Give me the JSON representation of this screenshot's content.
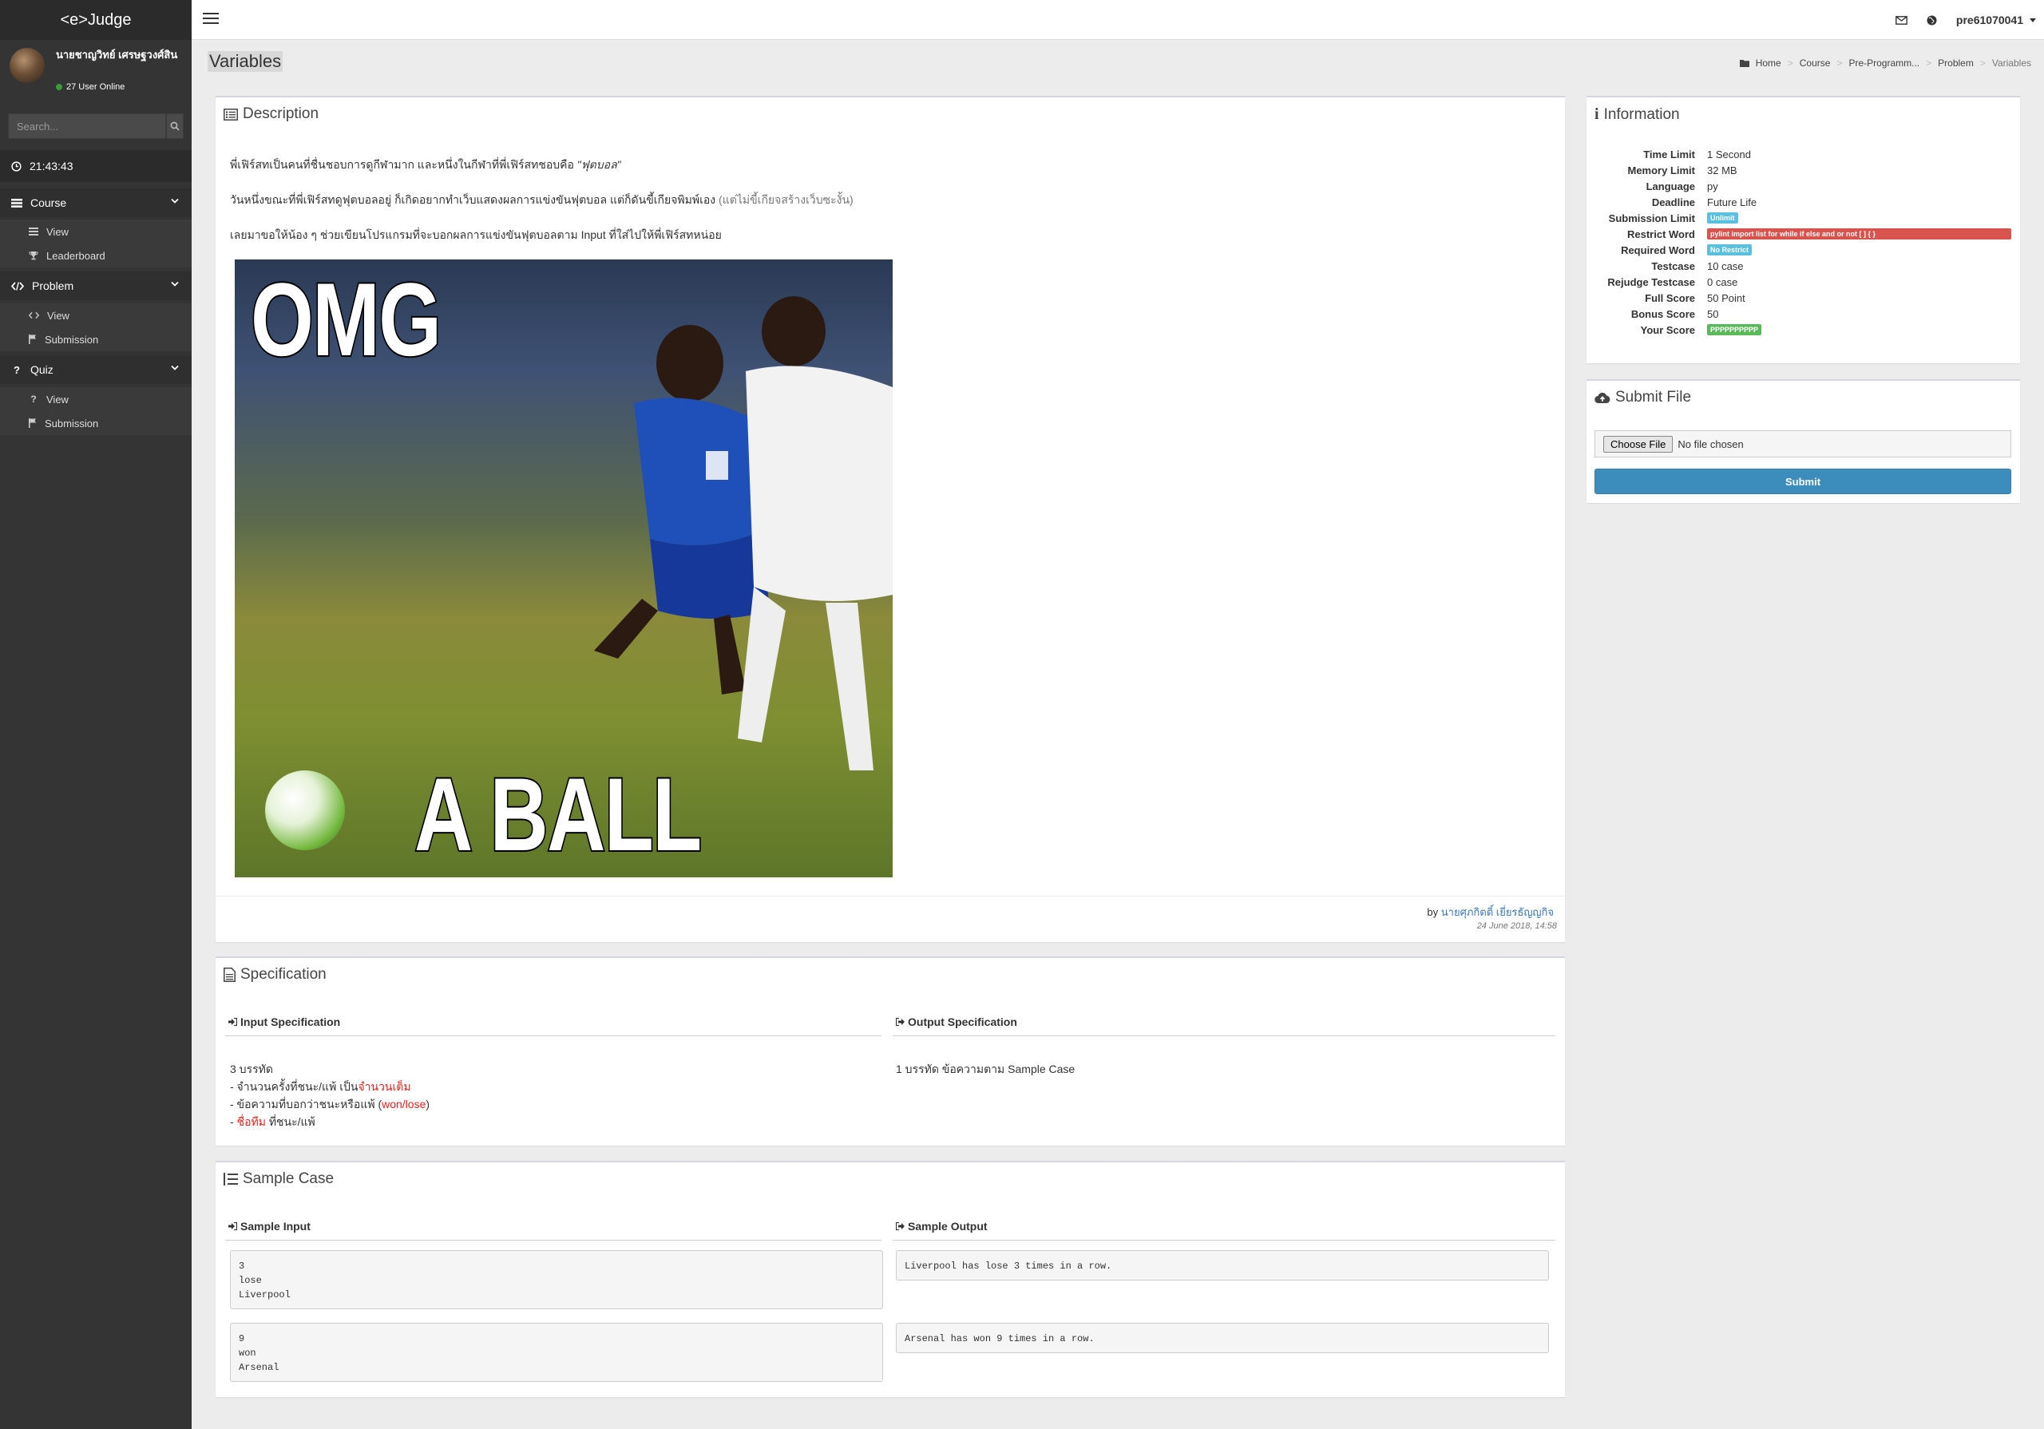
{
  "app": {
    "brand": "<e>Judge"
  },
  "user": {
    "name": "นายชาญวิทย์ เศรษฐวงศ์สิน",
    "online": "27 User Online",
    "username": "pre61070041"
  },
  "search": {
    "placeholder": "Search..."
  },
  "clock": "21:43:43",
  "menu": {
    "course": {
      "label": "Course",
      "items": [
        "View",
        "Leaderboard"
      ]
    },
    "problem": {
      "label": "Problem",
      "items": [
        "View",
        "Submission"
      ]
    },
    "quiz": {
      "label": "Quiz",
      "items": [
        "View",
        "Submission"
      ]
    }
  },
  "page": {
    "title": "Variables"
  },
  "breadcrumb": [
    "Home",
    "Course",
    "Pre-Programm...",
    "Problem",
    "Variables"
  ],
  "description": {
    "title": "Description",
    "p1_a": "พี่เฟิร์สทเป็นคนที่ชื่นชอบการดูกีฬามาก และหนึ่งในกีฬาที่พี่เฟิร์สทชอบคือ ",
    "p1_b": "\"ฟุตบอล\"",
    "p2_a": "วันหนึ่งขณะที่พี่เฟิร์สทดูฟุตบอลอยู่ ก็เกิดอยากทำเว็บแสดงผลการแข่งขันฟุตบอล แต่ก็ดันขี้เกียจพิมพ์เอง ",
    "p2_b": "(แต่ไม่ขี้เกียจสร้างเว็บซะงั้น)",
    "p3": "เลยมาขอให้น้อง ๆ ช่วยเขียนโปรแกรมที่จะบอกผลการแข่งขันฟุตบอลตาม Input ที่ใส่ไปให้พี่เฟิร์สทหน่อย",
    "meme_top": "OMG",
    "meme_bottom": "A BALL",
    "by": "by ",
    "author": "นายศุภกิตติ์ เยี่ยรธัญญกิจ",
    "date": "24 June 2018, 14:58"
  },
  "specification": {
    "title": "Specification",
    "input_title": "Input Specification",
    "output_title": "Output Specification",
    "input_l1": "3 บรรทัด",
    "input_l2_a": "- จำนวนครั้งที่ชนะ/แพ้ เป็น",
    "input_l2_b": "จำนวนเต็ม",
    "input_l3_a": "- ข้อความที่บอกว่าชนะหรือแพ้ (",
    "input_l3_b": "won/lose",
    "input_l3_c": ")",
    "input_l4_a": "- ",
    "input_l4_b": "ชื่อทีม",
    "input_l4_c": " ที่ชนะ/แพ้",
    "output_text": "1 บรรทัด ข้อความตาม Sample Case"
  },
  "sample": {
    "title": "Sample Case",
    "input_title": "Sample Input",
    "output_title": "Sample Output",
    "cases": [
      {
        "input": "3\nlose\nLiverpool",
        "output": "Liverpool has lose 3 times in a row."
      },
      {
        "input": "9\nwon\nArsenal",
        "output": "Arsenal has won 9 times in a row."
      }
    ]
  },
  "information": {
    "title": "Information",
    "rows": {
      "time_limit": {
        "label": "Time Limit",
        "value": "1 Second"
      },
      "memory_limit": {
        "label": "Memory Limit",
        "value": "32 MB"
      },
      "language": {
        "label": "Language",
        "value": "py"
      },
      "deadline": {
        "label": "Deadline",
        "value": "Future Life"
      },
      "submission_limit": {
        "label": "Submission Limit",
        "value": "Unlimit"
      },
      "restrict_word": {
        "label": "Restrict Word",
        "value": "pylint import list for while if else and or not [ ] { }"
      },
      "required_word": {
        "label": "Required Word",
        "value": "No Restrict"
      },
      "testcase": {
        "label": "Testcase",
        "value": "10 case"
      },
      "rejudge_testcase": {
        "label": "Rejudge Testcase",
        "value": "0 case"
      },
      "full_score": {
        "label": "Full Score",
        "value": "50 Point"
      },
      "bonus_score": {
        "label": "Bonus Score",
        "value": "50"
      },
      "your_score": {
        "label": "Your Score",
        "value": "PPPPPPPPPP"
      }
    }
  },
  "submit": {
    "title": "Submit File",
    "choose": "Choose File",
    "no_file": "No file chosen",
    "button": "Submit"
  },
  "colors": {
    "sidebar": "#343434",
    "primary": "#3c8dbc",
    "danger": "#d9534f",
    "info": "#5bc0de",
    "success": "#5cb85c",
    "accent_red": "#e0231c"
  }
}
